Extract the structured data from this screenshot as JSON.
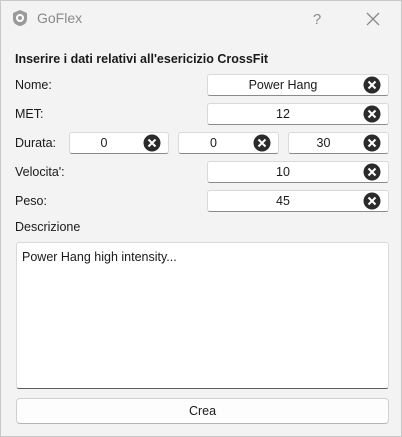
{
  "window": {
    "title": "GoFlex"
  },
  "form": {
    "heading": "Inserire i dati relativi all'esericizio CrossFit",
    "nome": {
      "label": "Nome:",
      "value": "Power Hang"
    },
    "met": {
      "label": "MET:",
      "value": "12"
    },
    "durata": {
      "label": "Durata:",
      "hours": "0",
      "minutes": "0",
      "seconds": "30"
    },
    "velocita": {
      "label": "Velocita':",
      "value": "10"
    },
    "peso": {
      "label": "Peso:",
      "value": "45"
    },
    "descrizione": {
      "label": "Descrizione",
      "value": "Power Hang high intensity..."
    },
    "create_label": "Crea"
  },
  "icons": {
    "clear": "clear-icon",
    "app": "goflex-icon",
    "help": "question-mark",
    "close": "close-icon"
  }
}
